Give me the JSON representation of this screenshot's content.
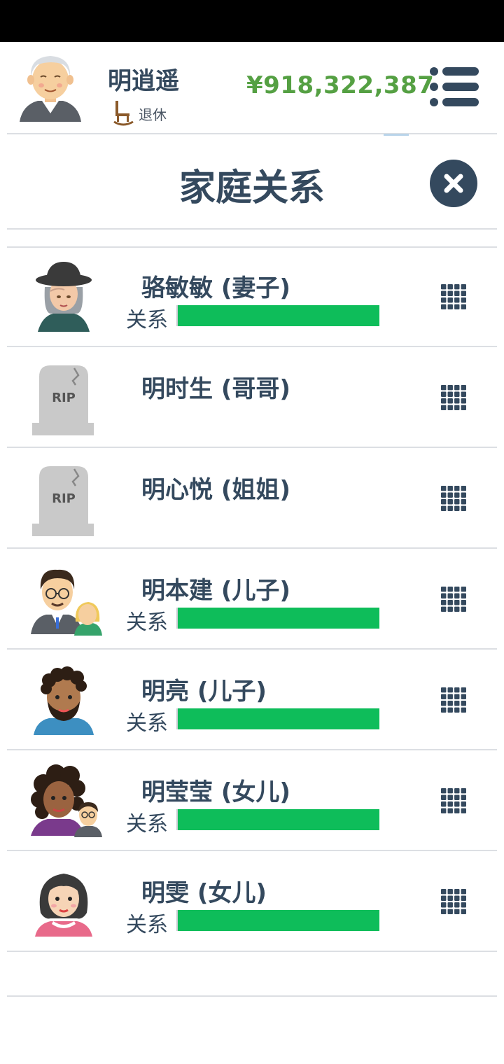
{
  "player": {
    "name": "明逍遥",
    "status": "退休",
    "money": "¥918,322,387",
    "avatar_icon": "elderly-man-avatar",
    "status_icon": "rocking-chair-icon"
  },
  "page": {
    "title": "家庭关系"
  },
  "family": [
    {
      "name": "骆敏敏 (妻子)",
      "relation_label": "关系",
      "relationship": 1.0,
      "avatar": "elderly-woman-hat"
    },
    {
      "name": "明时生 (哥哥)",
      "deceased": true,
      "avatar": "tombstone",
      "tombstone_text": "RIP"
    },
    {
      "name": "明心悦 (姐姐)",
      "deceased": true,
      "avatar": "tombstone",
      "tombstone_text": "RIP"
    },
    {
      "name": "明本建 (儿子)",
      "relation_label": "关系",
      "relationship": 1.0,
      "avatar": "man-glasses-with-partner"
    },
    {
      "name": "明亮 (儿子)",
      "relation_label": "关系",
      "relationship": 1.0,
      "avatar": "man-curly-beard"
    },
    {
      "name": "明莹莹 (女儿)",
      "relation_label": "关系",
      "relationship": 1.0,
      "avatar": "woman-curly-with-partner"
    },
    {
      "name": "明雯 (女儿)",
      "relation_label": "关系",
      "relationship": 1.0,
      "avatar": "woman-dark-hair"
    }
  ],
  "colors": {
    "text": "#34495e",
    "money": "#55a043",
    "relationship_bar": "#0ebd5a",
    "close_button": "#34495e"
  }
}
